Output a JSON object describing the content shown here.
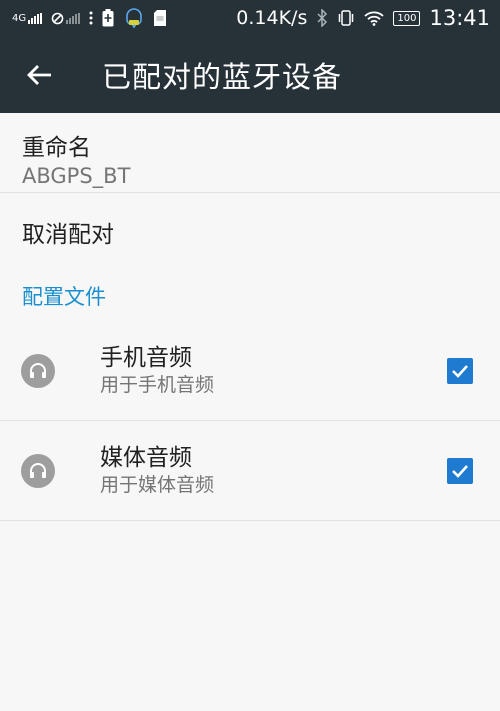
{
  "status_bar": {
    "network": "4G",
    "speed": "0.14K/s",
    "battery": "100",
    "time": "13:41"
  },
  "header": {
    "title": "已配对的蓝牙设备"
  },
  "rename": {
    "label": "重命名",
    "device_name": "ABGPS_BT"
  },
  "unpair": {
    "label": "取消配对"
  },
  "profiles_section": {
    "title": "配置文件"
  },
  "profiles": [
    {
      "title": "手机音频",
      "subtitle": "用于手机音频",
      "checked": true
    },
    {
      "title": "媒体音频",
      "subtitle": "用于媒体音频",
      "checked": true
    }
  ],
  "colors": {
    "toolbar": "#263238",
    "accent": "#1e7bcf",
    "section_title": "#1a8fcf"
  }
}
